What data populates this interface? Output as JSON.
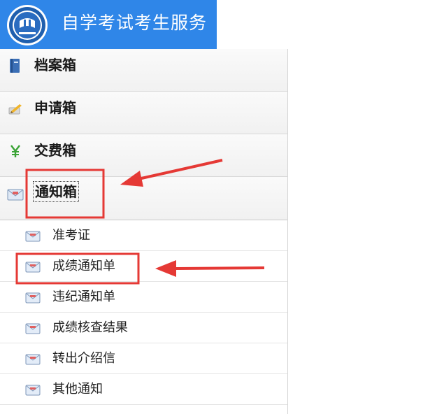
{
  "header": {
    "title": "自学考试考生服务"
  },
  "sidebar": {
    "boxes": [
      {
        "label": "档案箱"
      },
      {
        "label": "申请箱"
      },
      {
        "label": "交费箱"
      },
      {
        "label": "通知箱"
      }
    ],
    "notices": [
      {
        "label": "准考证"
      },
      {
        "label": "成绩通知单"
      },
      {
        "label": "违纪通知单"
      },
      {
        "label": "成绩核查结果"
      },
      {
        "label": "转出介绍信"
      },
      {
        "label": "其他通知"
      }
    ]
  },
  "colors": {
    "header_bg": "#2f86e8",
    "annotation_red": "#e53935"
  }
}
